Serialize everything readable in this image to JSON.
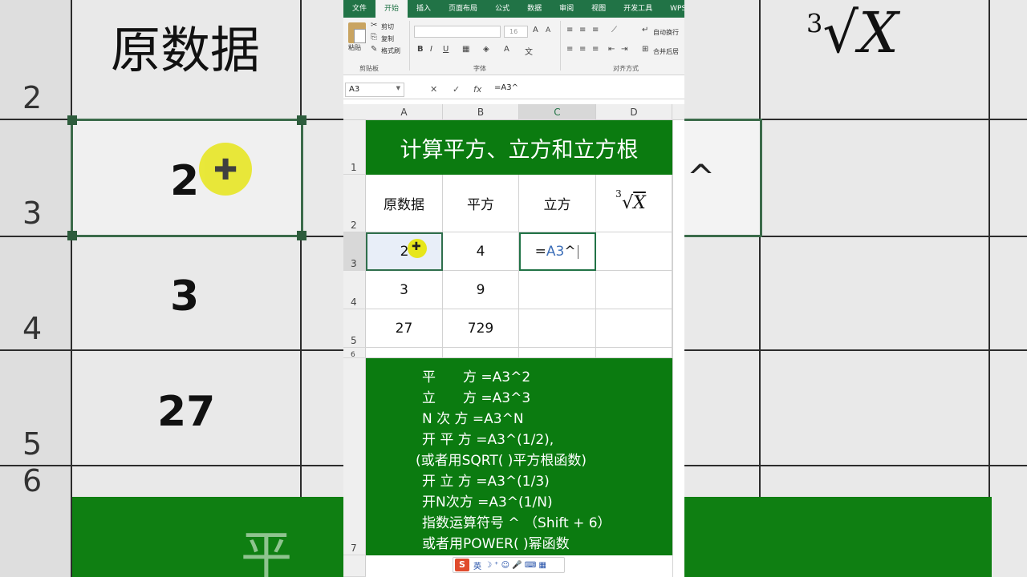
{
  "ribbon": {
    "tabs": [
      "文件",
      "开始",
      "插入",
      "页面布局",
      "公式",
      "数据",
      "审阅",
      "视图",
      "开发工具",
      "WPS"
    ],
    "active_tab": "开始",
    "paste": "粘贴",
    "cut": "剪切",
    "copy": "复制",
    "format_painter": "格式刷",
    "font_size": "16",
    "clipboard_group": "剪贴板",
    "font_group": "字体",
    "align_group": "对齐方式",
    "wrap_text": "自动换行",
    "merge_center": "合并后居"
  },
  "formula_bar": {
    "name_box": "A3",
    "formula": "=A3^"
  },
  "columns": [
    "A",
    "B",
    "C",
    "D"
  ],
  "rows": [
    "1",
    "2",
    "3",
    "4",
    "5",
    "6",
    "7"
  ],
  "sheet": {
    "title": "计算平方、立方和立方根",
    "headers": [
      "原数据",
      "平方",
      "立方"
    ],
    "cube_root_index": "3",
    "cube_root_var": "X",
    "row3": [
      "2",
      "4"
    ],
    "row3_formula_prefix": "=",
    "row3_formula_ref": "A3",
    "row3_formula_suffix": "^",
    "row4": [
      "3",
      "9"
    ],
    "row5": [
      "27",
      "729"
    ]
  },
  "notes": [
    "平　　方 =A3^2",
    "立　　方 =A3^3",
    "N 次 方 =A3^N",
    "开 平 方 =A3^(1/2),",
    "(或者用SQRT( )平方根函数)",
    "开 立 方 =A3^(1/3)",
    "开N次方 =A3^(1/N)",
    "指数运算符号 ^ （Shift + 6）",
    "或者用POWER( )幂函数"
  ],
  "ime": {
    "logo": "S",
    "lang": "英",
    "icons": "☽ ⁺ ☺ 🎤 ⌨ ▦"
  },
  "background": {
    "rows": [
      "2",
      "3",
      "4",
      "5",
      "6"
    ],
    "values": [
      "2",
      "3",
      "27"
    ],
    "header": "原数据",
    "green_text": "平",
    "caret": "^"
  }
}
